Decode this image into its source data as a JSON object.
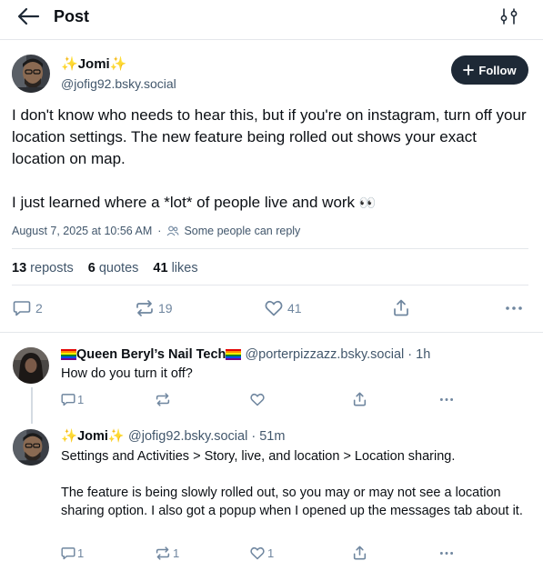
{
  "header": {
    "title": "Post"
  },
  "post": {
    "author": {
      "display_name": "Jomi",
      "handle": "@jofig92.bsky.social"
    },
    "follow_label": "Follow",
    "text_line1": "I don't know who needs to hear this, but if you're on instagram, turn off your location settings. The new feature being rolled out shows your exact location on map.",
    "text_line2": "I just learned where a *lot* of people live and work",
    "text_emoji": "👀",
    "timestamp": "August 7, 2025 at 10:56 AM",
    "separator": "·",
    "reply_setting": "Some people can reply",
    "stats": {
      "reposts_count": "13",
      "reposts_label": "reposts",
      "quotes_count": "6",
      "quotes_label": "quotes",
      "likes_count": "41",
      "likes_label": "likes"
    },
    "actions": {
      "replies": "2",
      "reposts": "19",
      "likes": "41"
    }
  },
  "replies": [
    {
      "display_name": "Queen Beryl’s Nail Tech",
      "handle": "@porterpizzazz.bsky.social",
      "time": "· 1h",
      "text": "How do you turn it off?",
      "actions": {
        "replies": "1",
        "reposts": "",
        "likes": ""
      }
    },
    {
      "display_name": "Jomi",
      "handle": "@jofig92.bsky.social",
      "time": "· 51m",
      "text_p1": "Settings and Activities > Story, live, and location > Location sharing.",
      "text_p2": "The feature is being slowly rolled out, so you may or may not see a location sharing option. I also got a popup when I opened up the messages tab about it.",
      "actions": {
        "replies": "1",
        "reposts": "1",
        "likes": "1"
      }
    }
  ],
  "colors": {
    "accent": "#1e2936",
    "muted": "#6f869f",
    "divider": "#e4e7eb"
  },
  "icons": [
    "back-arrow-icon",
    "filter-icon",
    "plus-icon",
    "people-icon",
    "reply-icon",
    "repost-icon",
    "heart-icon",
    "share-icon",
    "more-icon",
    "sparkle-icon",
    "rainbow-flag-icon"
  ]
}
